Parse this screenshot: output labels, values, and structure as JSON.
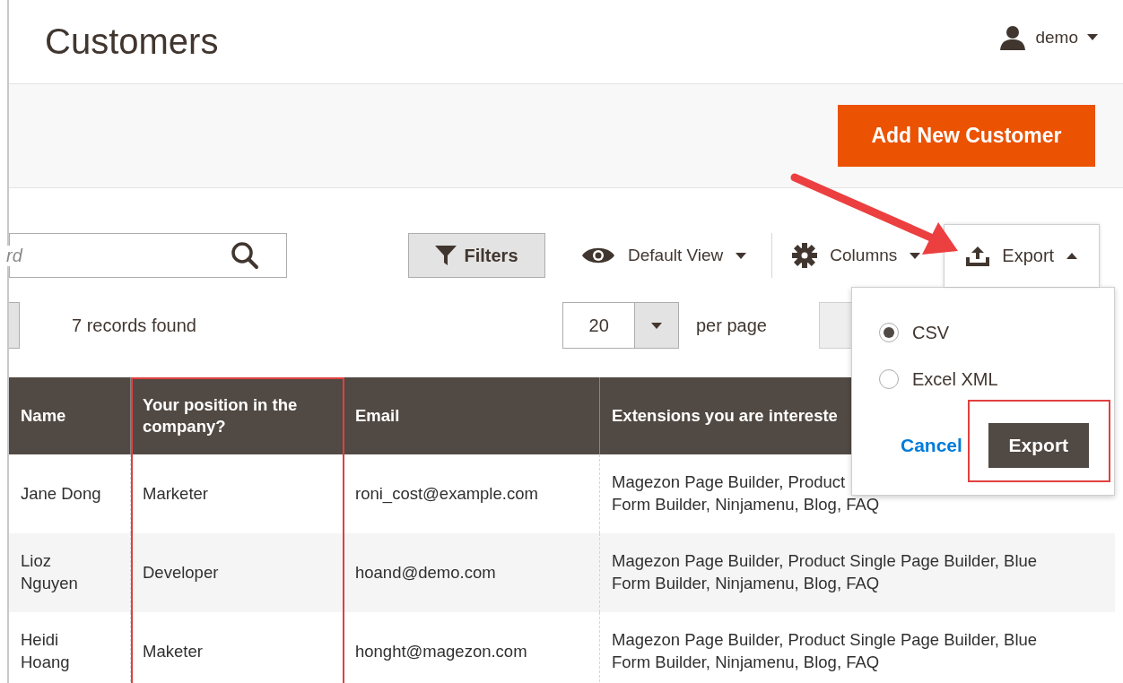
{
  "header": {
    "title": "Customers",
    "user": "demo"
  },
  "actions": {
    "primary_button": "Add New Customer"
  },
  "toolbar": {
    "search": {
      "placeholder": "rd"
    },
    "filters": "Filters",
    "view": "Default View",
    "columns": "Columns",
    "export": {
      "label": "Export",
      "expanded": true
    }
  },
  "records": "7 records found",
  "pagination": {
    "per_page_value": "20",
    "per_page_label": "per page"
  },
  "export_menu": {
    "options": [
      {
        "label": "CSV",
        "selected": true
      },
      {
        "label": "Excel XML",
        "selected": false
      }
    ],
    "cancel": "Cancel",
    "submit": "Export"
  },
  "table": {
    "columns": [
      "Name",
      "Your position in the company?",
      "Email",
      "Extensions you are intereste"
    ],
    "rows": [
      {
        "name": [
          "Jane Dong"
        ],
        "position": "Marketer",
        "email": "roni_cost@example.com",
        "extensions": [
          "Magezon Page Builder, Product",
          "Form Builder, Ninjamenu, Blog, FAQ"
        ]
      },
      {
        "name": [
          "Lioz",
          "Nguyen"
        ],
        "position": "Developer",
        "email": "hoand@demo.com",
        "extensions": [
          "Magezon Page Builder, Product Single Page Builder, Blue",
          "Form Builder, Ninjamenu, Blog, FAQ"
        ]
      },
      {
        "name": [
          "Heidi",
          "Hoang"
        ],
        "position": "Maketer",
        "email": "honght@magezon.com",
        "extensions": [
          "Magezon Page Builder, Product Single Page Builder, Blue",
          "Form Builder, Ninjamenu, Blog, FAQ"
        ]
      }
    ]
  }
}
